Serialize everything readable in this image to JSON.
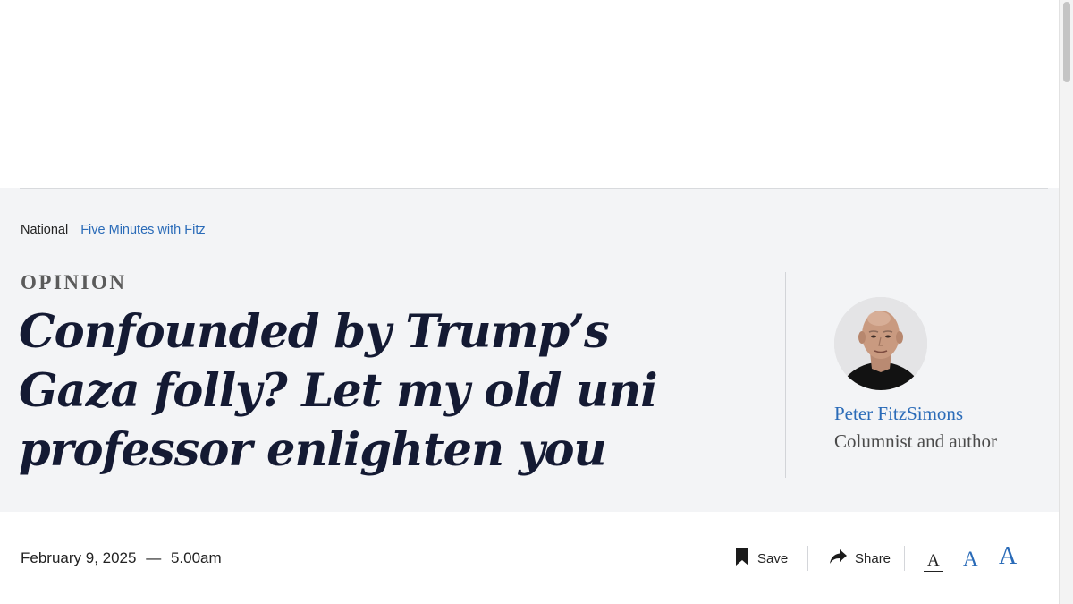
{
  "breadcrumb": {
    "section": "National",
    "subsection": "Five Minutes with Fitz"
  },
  "article": {
    "kicker": "OPINION",
    "headline": "Confounded by Trump’s Gaza folly? Let my old uni professor enlighten you",
    "date": "February 9, 2025",
    "separator": "—",
    "time": "5.00am"
  },
  "author": {
    "name": "Peter FitzSimons",
    "role": "Columnist and author"
  },
  "actions": {
    "save_label": "Save",
    "share_label": "Share",
    "font_sizes": [
      "A",
      "A",
      "A"
    ]
  },
  "icons": {
    "save": "bookmark-icon",
    "share": "share-arrow-icon"
  },
  "colors": {
    "header_bg": "#f3f4f6",
    "accent_link": "#2a6bb8",
    "headline": "#141a33"
  }
}
